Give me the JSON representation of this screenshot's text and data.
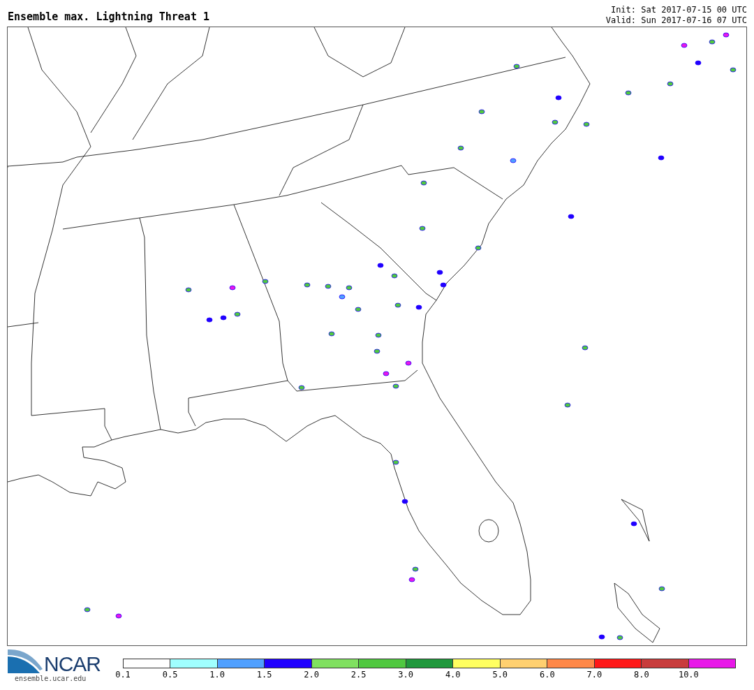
{
  "title": "Ensemble max. Lightning Threat 1",
  "init": "Init: Sat 2017-07-15 00 UTC",
  "valid": "Valid: Sun 2017-07-16 07 UTC",
  "logo": {
    "name": "NCAR",
    "url": "ensemble.ucar.edu"
  },
  "legend": {
    "bins": [
      {
        "color": "#ffffff"
      },
      {
        "color": "#a0ffff"
      },
      {
        "color": "#50a0ff"
      },
      {
        "color": "#2000ff"
      },
      {
        "color": "#80e060"
      },
      {
        "color": "#50c840"
      },
      {
        "color": "#20983c"
      },
      {
        "color": "#ffff60"
      },
      {
        "color": "#ffd070"
      },
      {
        "color": "#ff8848"
      },
      {
        "color": "#ff1818"
      },
      {
        "color": "#c83c3c"
      },
      {
        "color": "#e818e8"
      }
    ],
    "labels": [
      "0.1",
      "0.5",
      "1.0",
      "1.5",
      "2.0",
      "2.5",
      "3.0",
      "4.0",
      "5.0",
      "6.0",
      "7.0",
      "8.0",
      "10.0"
    ]
  }
}
